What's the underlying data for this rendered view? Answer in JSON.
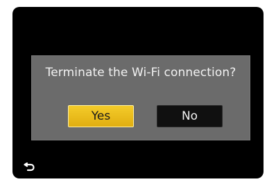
{
  "dialog": {
    "message": "Terminate the Wi-Fi connection?",
    "yes_label": "Yes",
    "no_label": "No"
  },
  "icons": {
    "back": "return-arrow-icon"
  },
  "colors": {
    "screen_background": "#000000",
    "dialog_background": "#6b6b6b",
    "yes_button": "#f0c21f",
    "no_button": "#101010",
    "text": "#f2f2f2"
  }
}
